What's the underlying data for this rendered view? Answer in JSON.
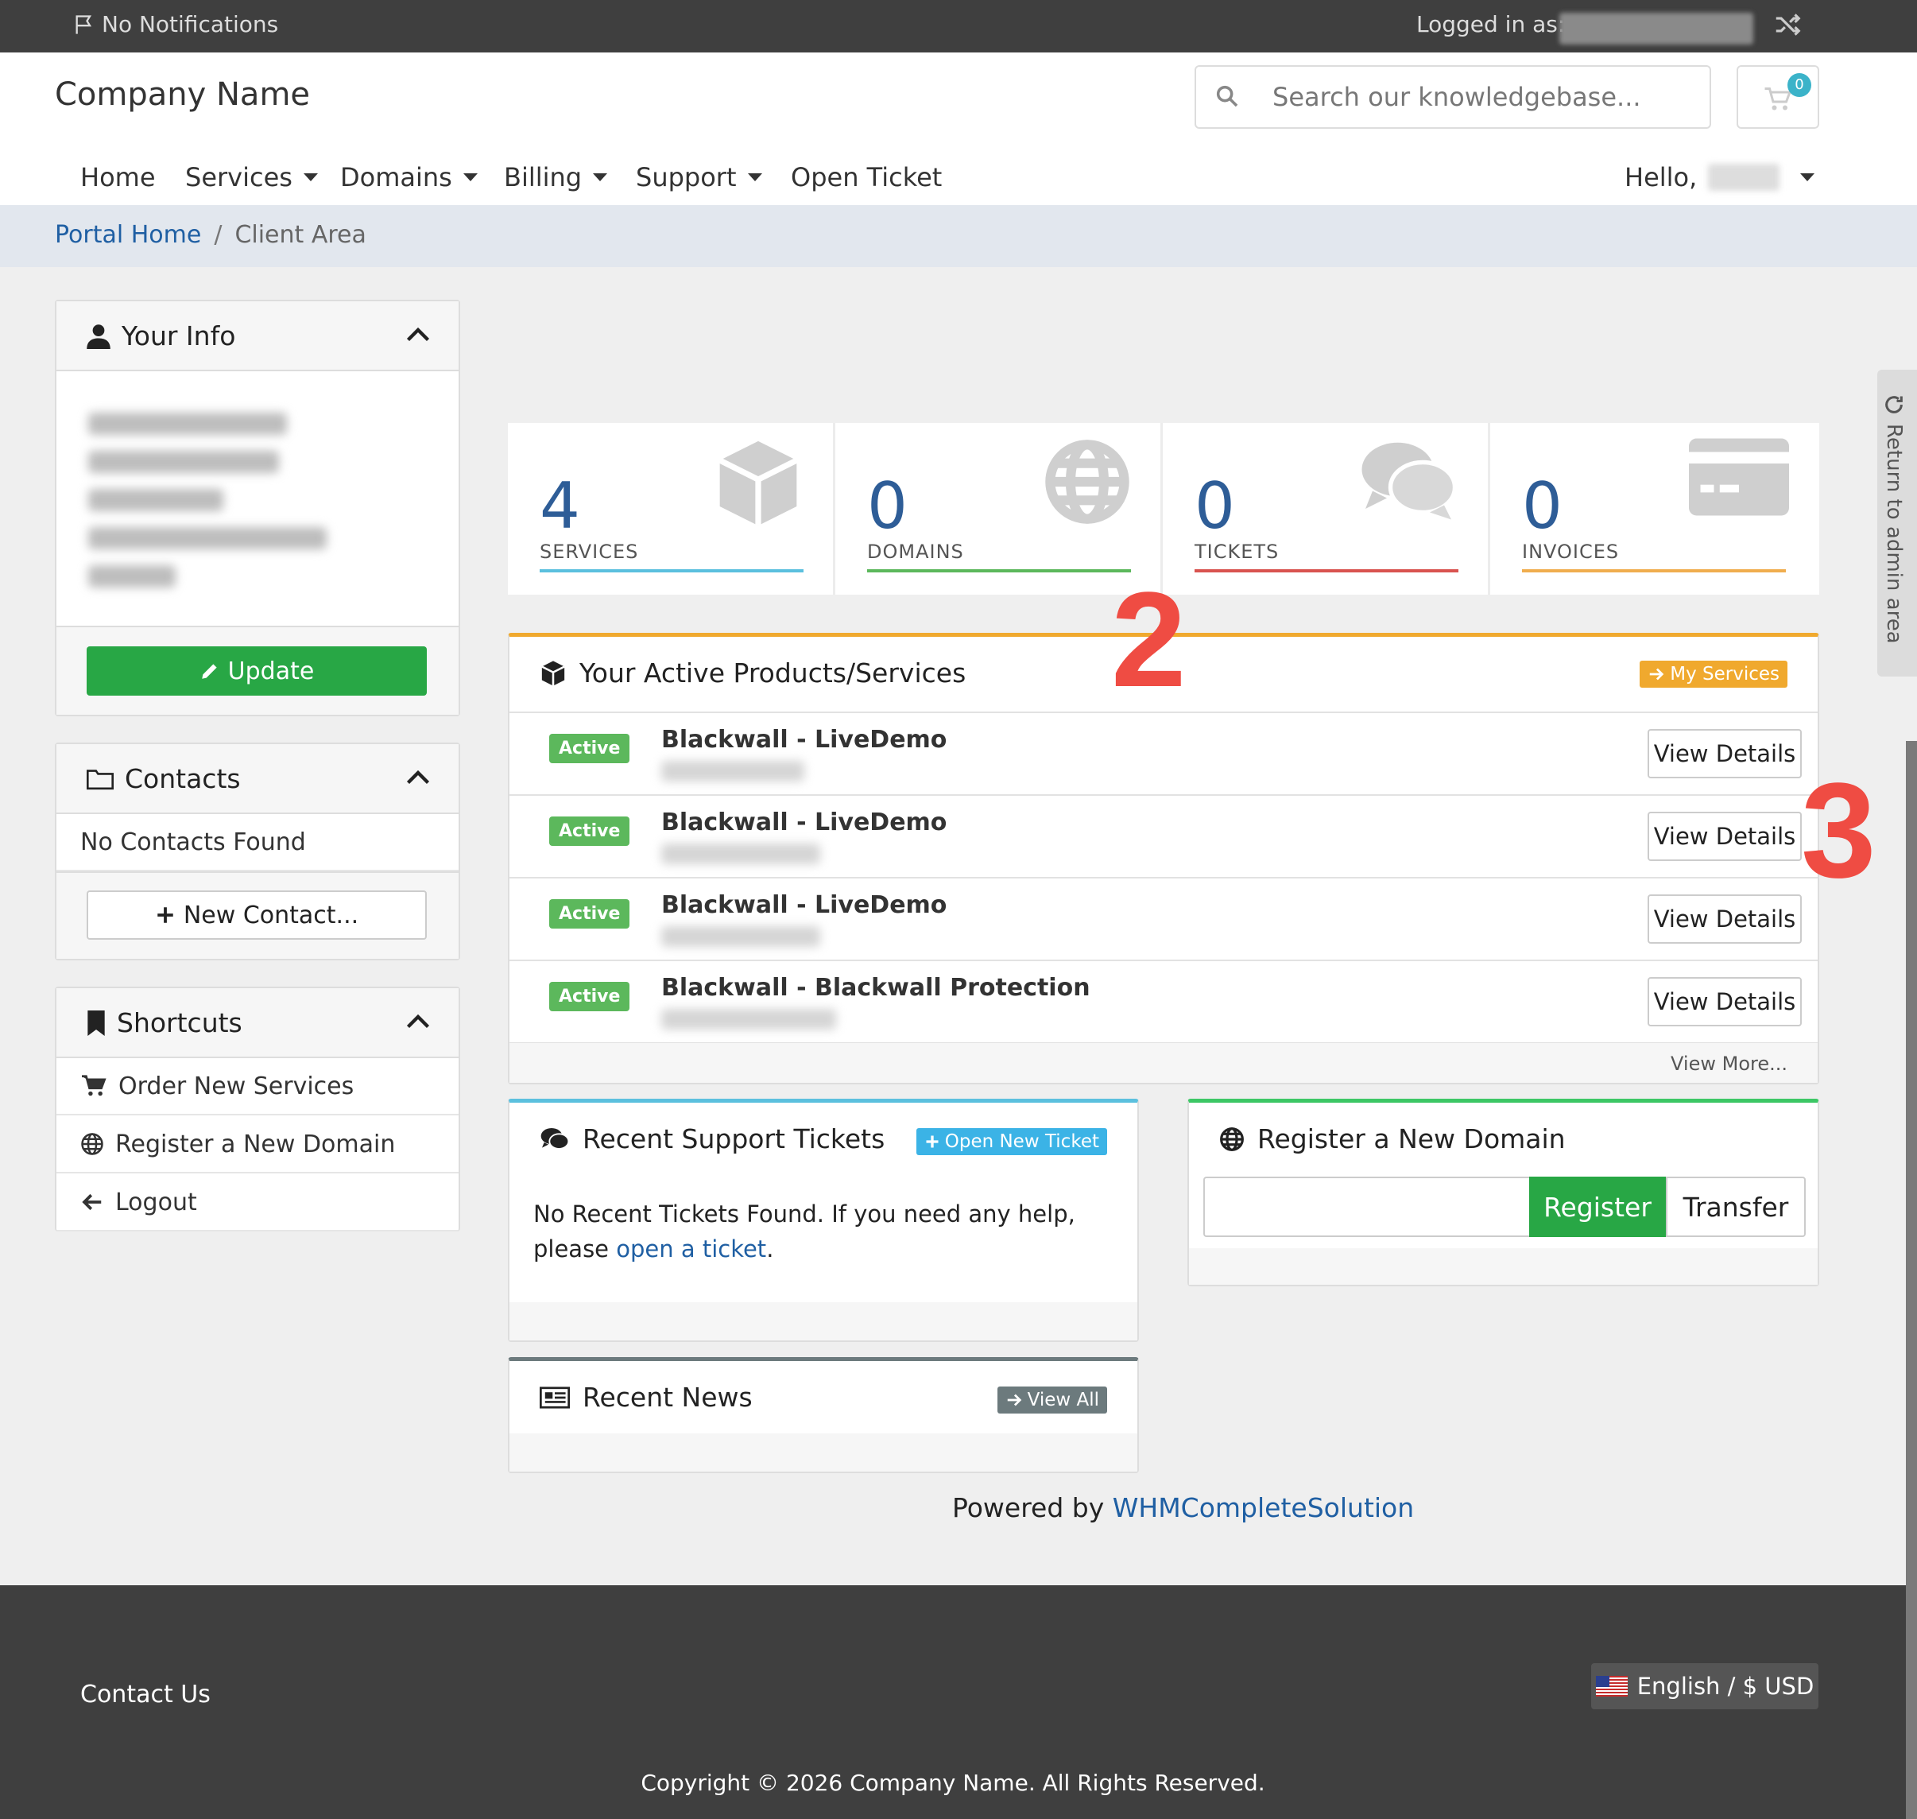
{
  "topbar": {
    "notifications": "No Notifications",
    "logged_in_as": "Logged in as:"
  },
  "header": {
    "brand": "Company Name",
    "search_placeholder": "Search our knowledgebase...",
    "cart_count": "0"
  },
  "nav": {
    "items": [
      "Home",
      "Services",
      "Domains",
      "Billing",
      "Support",
      "Open Ticket"
    ],
    "hello": "Hello,"
  },
  "breadcrumb": {
    "home": "Portal Home",
    "separator": "/",
    "current": "Client Area"
  },
  "your_info": {
    "title": "Your Info",
    "update": "Update"
  },
  "contacts": {
    "title": "Contacts",
    "empty": "No Contacts Found",
    "new_contact": "New Contact..."
  },
  "shortcuts": {
    "title": "Shortcuts",
    "items": [
      "Order New Services",
      "Register a New Domain",
      "Logout"
    ]
  },
  "stats": [
    {
      "value": "4",
      "label": "SERVICES",
      "color": "#5bc0de"
    },
    {
      "value": "0",
      "label": "DOMAINS",
      "color": "#5cb85c"
    },
    {
      "value": "0",
      "label": "TICKETS",
      "color": "#d9534f"
    },
    {
      "value": "0",
      "label": "INVOICES",
      "color": "#f0ad4e"
    }
  ],
  "products": {
    "title": "Your Active Products/Services",
    "my_services": "My Services",
    "rows": [
      {
        "status": "Active",
        "name": "Blackwall - LiveDemo",
        "action": "View Details"
      },
      {
        "status": "Active",
        "name": "Blackwall - LiveDemo",
        "action": "View Details"
      },
      {
        "status": "Active",
        "name": "Blackwall - LiveDemo",
        "action": "View Details"
      },
      {
        "status": "Active",
        "name": "Blackwall - Blackwall Protection",
        "action": "View Details"
      }
    ],
    "view_more": "View More..."
  },
  "tickets": {
    "title": "Recent Support Tickets",
    "button": "Open New Ticket",
    "text": "No Recent Tickets Found. If you need any help, please",
    "link": "open a ticket",
    "period": "."
  },
  "domain": {
    "title": "Register a New Domain",
    "register": "Register",
    "transfer": "Transfer"
  },
  "news": {
    "title": "Recent News",
    "button": "View All"
  },
  "powered": {
    "prefix": "Powered by",
    "link": "WHMCompleteSolution"
  },
  "admin_tab": "Return to admin area",
  "annotations": [
    "2",
    "3"
  ],
  "footer": {
    "contact": "Contact Us",
    "language": "English / $ USD",
    "copyright": "Copyright © 2026 Company Name. All Rights Reserved."
  },
  "colors": {
    "accent_orange": "#f0a92e",
    "green": "#28a745",
    "link_blue": "#1f5fa3",
    "annotation_red": "#ef4c43"
  }
}
